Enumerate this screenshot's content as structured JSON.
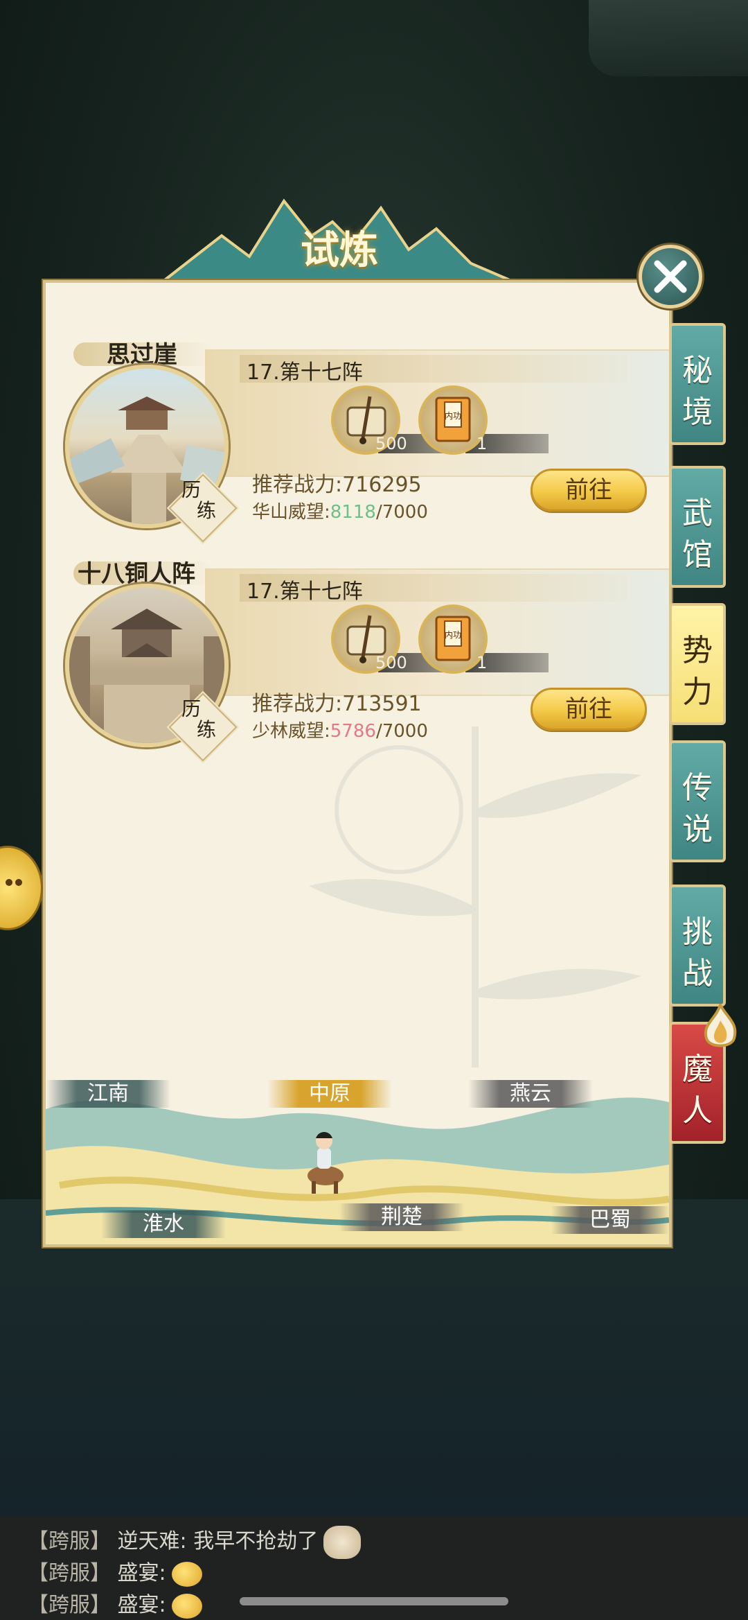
{
  "screen": {
    "title": "试炼"
  },
  "trials": [
    {
      "place": "思过崖",
      "stage": "17.第十七阵",
      "tag": [
        "历",
        "练"
      ],
      "rewards": [
        {
          "icon": "scroll-icon",
          "count": "500"
        },
        {
          "icon": "neigong-book-icon",
          "count": "1"
        }
      ],
      "power_label": "推荐战力:",
      "power_value": "716295",
      "prestige_label": "华山威望:",
      "prestige_current": "8118",
      "prestige_required": "/7000",
      "prestige_color": "#6cc08a",
      "go_label": "前往"
    },
    {
      "place": "十八铜人阵",
      "stage": "17.第十七阵",
      "tag": [
        "历",
        "练"
      ],
      "rewards": [
        {
          "icon": "scroll-icon",
          "count": "500"
        },
        {
          "icon": "neigong-book-icon",
          "count": "1"
        }
      ],
      "power_label": "推荐战力:",
      "power_value": "713591",
      "prestige_label": "少林威望:",
      "prestige_current": "5786",
      "prestige_required": "/7000",
      "prestige_color": "#e07a8a",
      "go_label": "前往"
    }
  ],
  "reward_book_label": "内功",
  "side_tabs": [
    {
      "c1": "秘",
      "c2": "境",
      "state": "normal"
    },
    {
      "c1": "武",
      "c2": "馆",
      "state": "normal"
    },
    {
      "c1": "势",
      "c2": "力",
      "state": "active"
    },
    {
      "c1": "传",
      "c2": "说",
      "state": "normal"
    },
    {
      "c1": "挑",
      "c2": "战",
      "state": "normal"
    },
    {
      "c1": "魔",
      "c2": "人",
      "state": "red"
    }
  ],
  "regions": {
    "jiangnan": "江南",
    "zhongyuan": "中原",
    "yanyun": "燕云",
    "huaishui": "淮水",
    "jingchu": "荆楚",
    "bashu": "巴蜀",
    "selected": "中原"
  },
  "chat": [
    {
      "channel": "【跨服】",
      "speaker": "逆天难:",
      "message": "我早不抢劫了"
    },
    {
      "channel": "【跨服】",
      "speaker": "盛宴:",
      "message": ""
    },
    {
      "channel": "【跨服】",
      "speaker": "盛宴:",
      "message": ""
    }
  ],
  "colors": {
    "accent_gold": "#f3c947",
    "tab_teal": "#3f8683",
    "tab_active": "#f5df75",
    "tab_red": "#a2222a"
  }
}
